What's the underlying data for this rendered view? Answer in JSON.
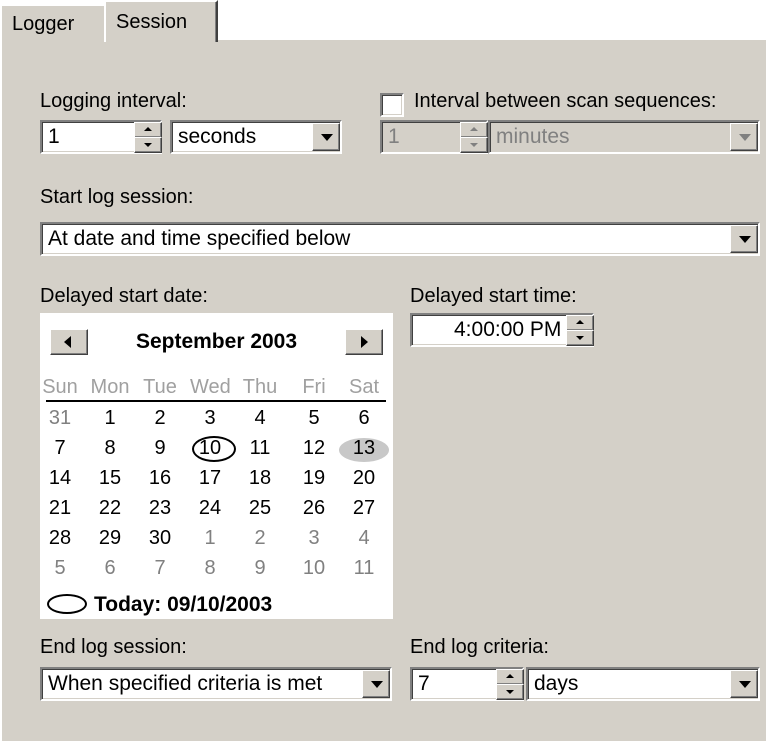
{
  "tabs": [
    "Logger",
    "Session"
  ],
  "logging_interval": {
    "label": "Logging interval:",
    "value": "1",
    "unit": "seconds"
  },
  "scan_interval": {
    "label": "Interval between scan sequences:",
    "checked": false,
    "value": "1",
    "unit": "minutes"
  },
  "start_session": {
    "label": "Start log session:",
    "value": "At date and time specified below"
  },
  "delayed_start_date": {
    "label": "Delayed start date:"
  },
  "calendar": {
    "month_year": "September 2003",
    "weekdays": [
      "Sun",
      "Mon",
      "Tue",
      "Wed",
      "Thu",
      "Fri",
      "Sat"
    ],
    "weeks": [
      [
        "31",
        "1",
        "2",
        "3",
        "4",
        "5",
        "6"
      ],
      [
        "7",
        "8",
        "9",
        "10",
        "11",
        "12",
        "13"
      ],
      [
        "14",
        "15",
        "16",
        "17",
        "18",
        "19",
        "20"
      ],
      [
        "21",
        "22",
        "23",
        "24",
        "25",
        "26",
        "27"
      ],
      [
        "28",
        "29",
        "30",
        "1",
        "2",
        "3",
        "4"
      ],
      [
        "5",
        "6",
        "7",
        "8",
        "9",
        "10",
        "11"
      ]
    ],
    "selected_day": "13",
    "today_day": "10",
    "today_label": "Today: 09/10/2003"
  },
  "delayed_start_time": {
    "label": "Delayed start time:",
    "value": "4:00:00 PM"
  },
  "end_session": {
    "label": "End log session:",
    "value": "When specified criteria is met"
  },
  "end_criteria": {
    "label": "End log criteria:",
    "value": "7",
    "unit": "days"
  }
}
